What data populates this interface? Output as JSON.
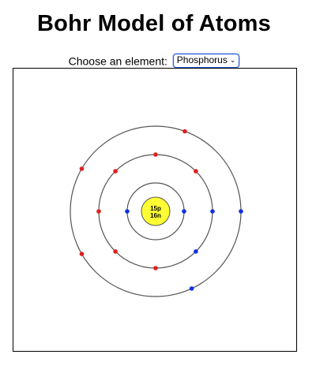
{
  "page": {
    "title": "Bohr Model of Atoms"
  },
  "chooser": {
    "label": "Choose an element:",
    "selected_element": "Phosphorus",
    "chevron_icon": "chevron-down-icon"
  },
  "atom": {
    "element": "Phosphorus",
    "protons_label": "15p",
    "neutrons_label": "16n",
    "shells": [
      {
        "shell": 1,
        "electrons": 2
      },
      {
        "shell": 2,
        "electrons": 8
      },
      {
        "shell": 3,
        "electrons": 5
      }
    ],
    "colors": {
      "nucleus_fill": "#ffff33",
      "nucleus_stroke": "#555555",
      "orbit": "#555555",
      "electron_red": "#e0201e",
      "electron_blue": "#1030e0"
    }
  }
}
